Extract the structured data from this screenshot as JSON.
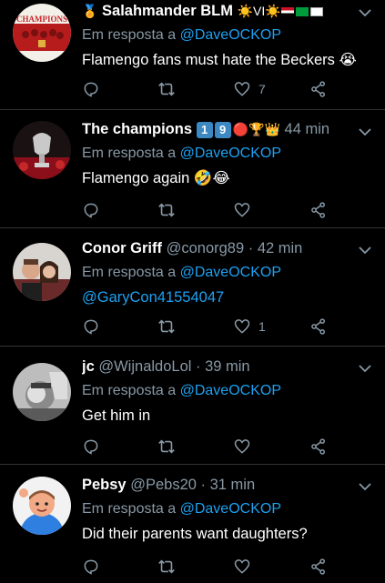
{
  "tweets": [
    {
      "name": "Salahmander BLM",
      "handle": "",
      "time": "",
      "reply_prefix": "Em resposta a",
      "reply_to": "@DaveOCKOP",
      "text": "Flamengo fans must hate the Beckers",
      "likes": "7",
      "avatar_text": "CHAMPIONS"
    },
    {
      "name": "The champions",
      "handle": "",
      "time": "44 min",
      "reply_prefix": "Em resposta a",
      "reply_to": "@DaveOCKOP",
      "text": "Flamengo again",
      "likes": ""
    },
    {
      "name": "Conor Griff",
      "handle": "@conorg89",
      "time": "· 42 min",
      "reply_prefix": "Em resposta a",
      "reply_to": "@DaveOCKOP",
      "text": "@GaryCon41554047",
      "likes": "1"
    },
    {
      "name": "jc",
      "handle": "@WijnaldoLol",
      "time": "· 39 min",
      "reply_prefix": "Em resposta a",
      "reply_to": "@DaveOCKOP",
      "text": "Get him in",
      "likes": ""
    },
    {
      "name": "Pebsy",
      "handle": "@Pebs20",
      "time": "· 31 min",
      "reply_prefix": "Em resposta a",
      "reply_to": "@DaveOCKOP",
      "text": "Did their parents want daughters?",
      "likes": ""
    }
  ],
  "badges": {
    "t2_number_1": "1",
    "t2_number_2": "9"
  },
  "colors": {
    "background": "#000000",
    "text_secondary": "#8899a6",
    "link": "#1da1f2",
    "divider": "#2f3336"
  }
}
